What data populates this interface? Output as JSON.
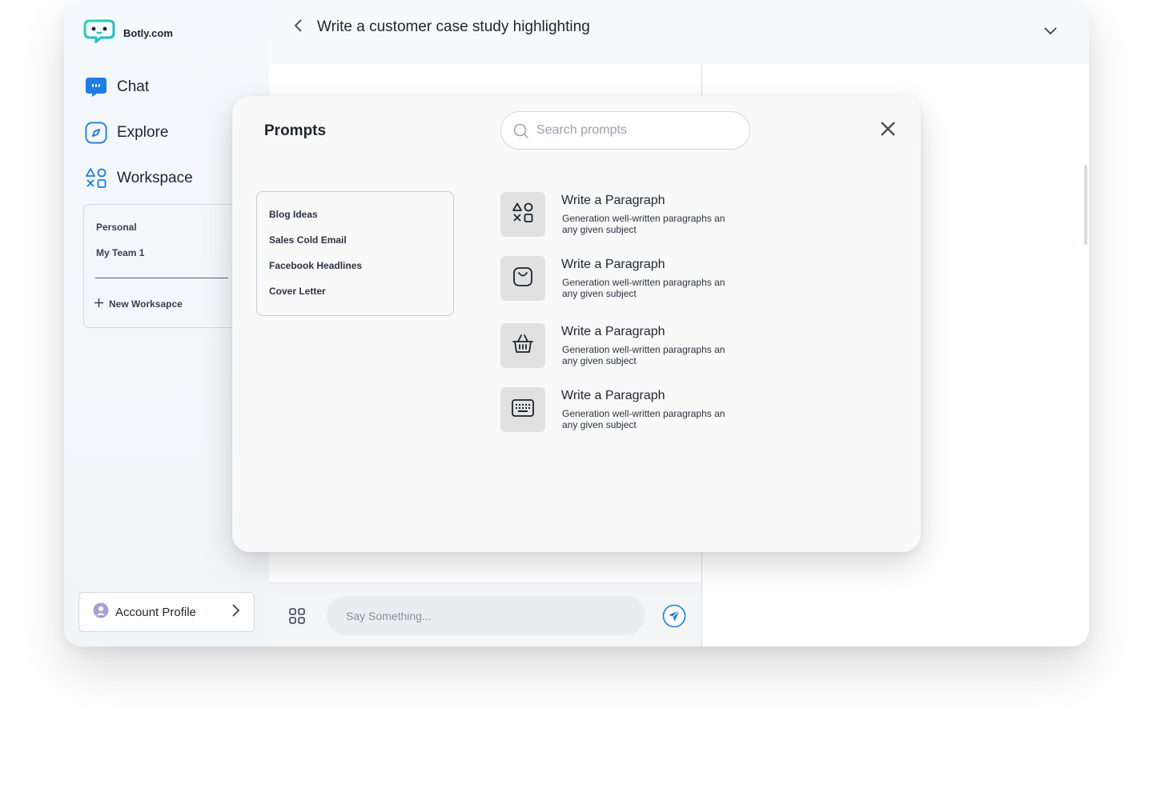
{
  "brand": {
    "name": "Botly.com"
  },
  "nav": [
    {
      "label": "Chat",
      "icon": "chat-icon"
    },
    {
      "label": "Explore",
      "icon": "compass-icon"
    },
    {
      "label": "Workspace",
      "icon": "shapes-icon"
    }
  ],
  "workspace": {
    "items": [
      "Personal",
      "My Team 1"
    ],
    "new_label": "New Worksapce"
  },
  "account": {
    "label": "Account Profile"
  },
  "topbar": {
    "title": "Write a customer case study highlighting"
  },
  "composer": {
    "placeholder": "Say Something..."
  },
  "modal": {
    "title": "Prompts",
    "search_placeholder": "Search prompts",
    "categories": [
      "Blog Ideas",
      "Sales Cold Email",
      "Facebook Headlines",
      "Cover Letter"
    ],
    "prompts": [
      {
        "title": "Write a Paragraph",
        "description": "Generation well-written paragraphs an any given subject",
        "icon": "shapes-icon"
      },
      {
        "title": "Write a Paragraph",
        "description": "Generation well-written paragraphs an any given subject",
        "icon": "shopping-bag-icon"
      },
      {
        "title": "Write a Paragraph",
        "description": "Generation well-written paragraphs an any given subject",
        "icon": "basket-icon"
      },
      {
        "title": "Write a Paragraph",
        "description": "Generation well-written paragraphs an any given subject",
        "icon": "keyboard-icon"
      }
    ]
  },
  "colors": {
    "accent": "#1d7de3",
    "brand": "#22c4b8",
    "sidebar_bg": "#f3f7fa"
  }
}
